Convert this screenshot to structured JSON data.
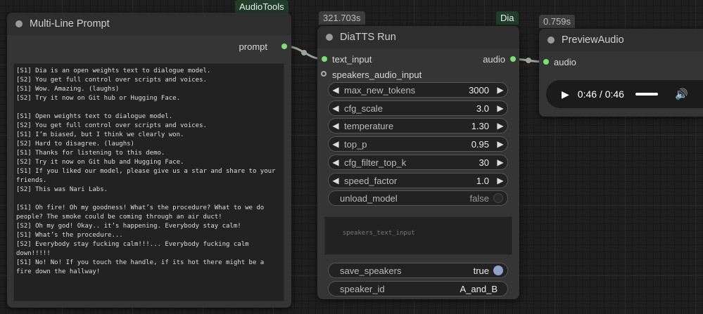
{
  "badges": {
    "audiotools": "AudioTools",
    "dia": "Dia",
    "diatts_time": "321.703s",
    "preview_time": "0.759s"
  },
  "multiline_node": {
    "title": "Multi-Line Prompt",
    "output_label": "prompt",
    "prompt_text": "[S1] Dia is an open weights text to dialogue model.\n[S2] You get full control over scripts and voices.\n[S1] Wow. Amazing. (laughs)\n[S2] Try it now on Git hub or Hugging Face.\n\n[S1] Open weights text to dialogue model.\n[S2] You get full control over scripts and voices.\n[S1] I’m biased, but I think we clearly won.\n[S2] Hard to disagree. (laughs)\n[S1] Thanks for listening to this demo.\n[S2] Try it now on Git hub and Hugging Face.\n[S1] If you liked our model, please give us a star and share to your friends.\n[S2] This was Nari Labs.\n\n[S1] Oh fire! Oh my goodness! What’s the procedure? What to we do people? The smoke could be coming through an air duct!\n[S2] Oh my god! Okay.. it’s happening. Everybody stay calm!\n[S1] What’s the procedure...\n[S2] Everybody stay fucking calm!!!... Everybody fucking calm down!!!!!\n[S1] No! No! If you touch the handle, if its hot there might be a fire down the hallway!"
  },
  "diatts_node": {
    "title": "DiaTTS Run",
    "inputs": {
      "text_input": "text_input",
      "speakers_audio_input": "speakers_audio_input"
    },
    "output_label": "audio",
    "widgets": [
      {
        "label": "max_new_tokens",
        "value": "3000"
      },
      {
        "label": "cfg_scale",
        "value": "3.0"
      },
      {
        "label": "temperature",
        "value": "1.30"
      },
      {
        "label": "top_p",
        "value": "0.95"
      },
      {
        "label": "cfg_filter_top_k",
        "value": "30"
      },
      {
        "label": "speed_factor",
        "value": "1.0"
      }
    ],
    "unload_model": {
      "label": "unload_model",
      "value": "false"
    },
    "speakers_text_placeholder": "speakers_text_input",
    "save_speakers": {
      "label": "save_speakers",
      "value": "true"
    },
    "speaker_id": {
      "label": "speaker_id",
      "value": "A_and_B"
    }
  },
  "preview_node": {
    "title": "PreviewAudio",
    "input_label": "audio",
    "player": {
      "time": "0:46 / 0:46",
      "progress": 1.0
    }
  },
  "colors": {
    "slot_green": "#7CE072",
    "toggle_off": "#2a2a2a",
    "toggle_on": "#8fa3c7",
    "link": "#9aa69c"
  }
}
